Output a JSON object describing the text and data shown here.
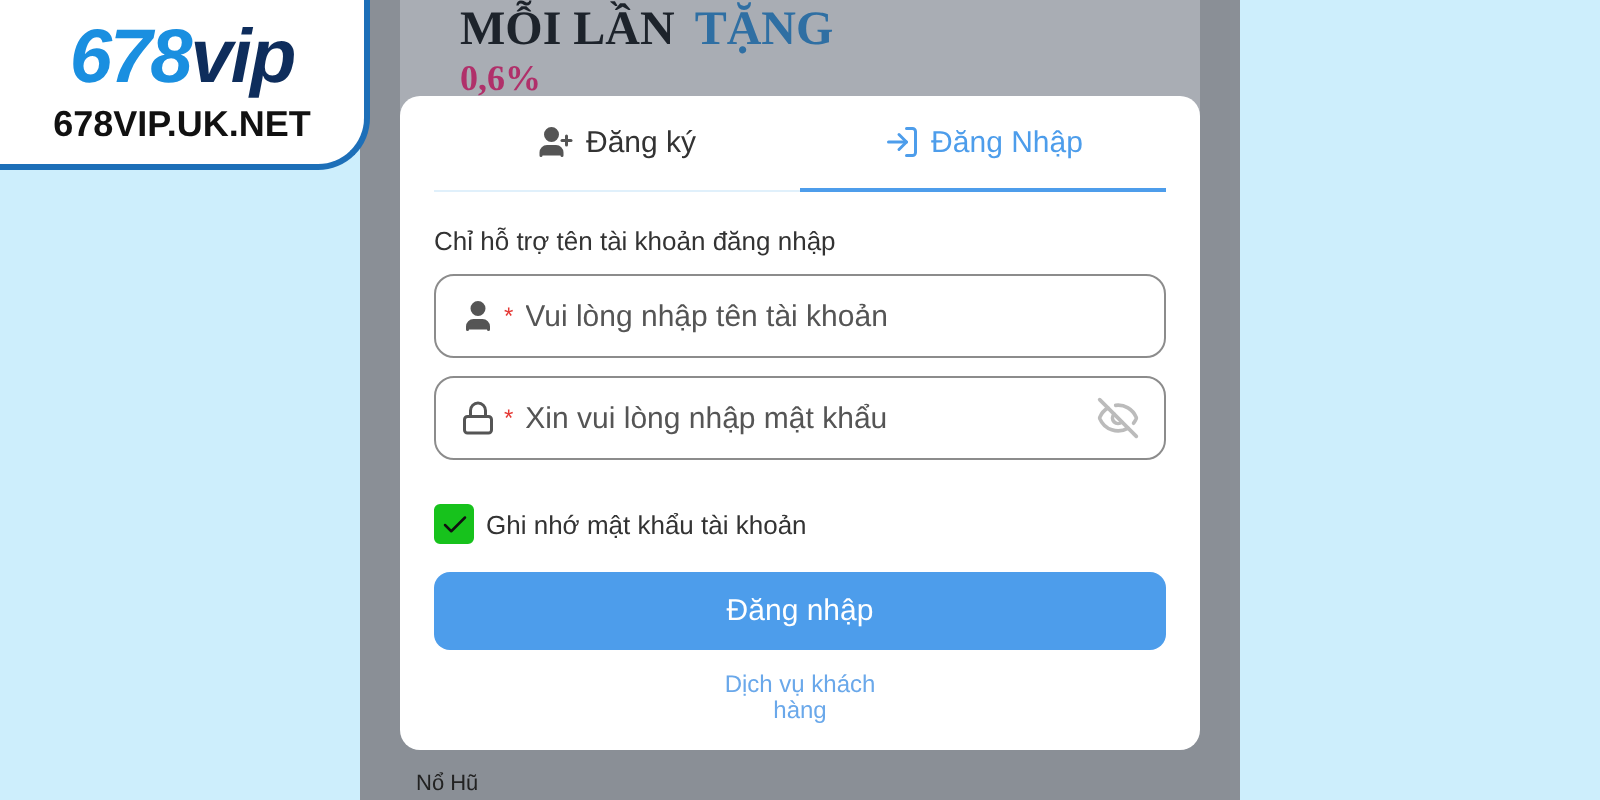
{
  "logo": {
    "brand_number": "678",
    "brand_word": "vip",
    "domain": "678VIP.UK.NET"
  },
  "background": {
    "banner": [
      {
        "text": "MỖI LẦN",
        "kind": "dark"
      },
      {
        "text": "TẶNG",
        "kind": "accent"
      },
      {
        "text": "0,6%",
        "kind": "pink"
      }
    ],
    "game_label": "Nổ Hũ"
  },
  "tabs": [
    {
      "label": "Đăng ký",
      "selected": false
    },
    {
      "label": "Đăng Nhập",
      "selected": true
    }
  ],
  "hint": "Chỉ hỗ trợ tên tài khoản đăng nhập",
  "fields": [
    {
      "kind": "text",
      "placeholder": "Vui lòng nhập tên tài khoản",
      "required_mark": "*"
    },
    {
      "kind": "password",
      "placeholder": "Xin vui lòng nhập mật khẩu",
      "required_mark": "*"
    }
  ],
  "remember": {
    "label": "Ghi nhớ mật khẩu tài khoản",
    "checked": true
  },
  "submit": "Đăng nhập",
  "support_link": "Dịch vụ khách hàng"
}
